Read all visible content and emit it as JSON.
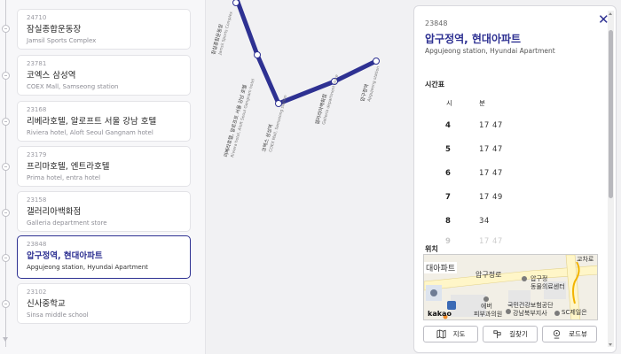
{
  "stops": [
    {
      "code": "24710",
      "ko": "잠실종합운동장",
      "en": "Jamsil Sports Complex",
      "active": false
    },
    {
      "code": "23781",
      "ko": "코엑스 삼성역",
      "en": "COEX Mall, Samseong station",
      "active": false
    },
    {
      "code": "23168",
      "ko": "리베라호텔, 알로프트 서울 강남 호텔",
      "en": "Riviera hotel, Aloft Seoul Gangnam hotel",
      "active": false
    },
    {
      "code": "23179",
      "ko": "프리마호텔, 엔트라호텔",
      "en": "Prima hotel, entra hotel",
      "active": false
    },
    {
      "code": "23158",
      "ko": "갤러리아백화점",
      "en": "Galleria department store",
      "active": false
    },
    {
      "code": "23848",
      "ko": "압구정역, 현대아파트",
      "en": "Apgujeong station, Hyundai Apartment",
      "active": true
    },
    {
      "code": "23102",
      "ko": "신사중학교",
      "en": "Sinsa middle school",
      "active": false
    }
  ],
  "route_labels": [
    {
      "ko": "잠실종합운동장",
      "en": "Jamsil Sports Complex"
    },
    {
      "ko": "리베라호텔, 알로프트 서울 강남 호텔",
      "en": "Riviera hotel, Aloft Seoul Gangnam hotel"
    },
    {
      "ko": "코엑스 삼성역",
      "en": "COEX Mall, Samseong station"
    },
    {
      "ko": "갤러리아백화점",
      "en": "Galleria department store"
    },
    {
      "ko": "압구정역",
      "en": "Apgujeong station"
    }
  ],
  "detail": {
    "code": "23848",
    "title": "압구정역, 현대아파트",
    "subtitle": "Apgujeong station, Hyundai Apartment",
    "close_icon": "close-icon",
    "timetable_title": "시간표",
    "timetable_header": {
      "hour": "시",
      "minute": "분"
    },
    "timetable": [
      {
        "hour": "4",
        "minutes": "17  47"
      },
      {
        "hour": "5",
        "minutes": "17  47"
      },
      {
        "hour": "6",
        "minutes": "17  47"
      },
      {
        "hour": "7",
        "minutes": "17  49"
      },
      {
        "hour": "8",
        "minutes": "34"
      },
      {
        "hour": "9",
        "minutes": "17  47"
      }
    ],
    "location_title": "위치",
    "map_labels": {
      "station": "압구정",
      "station_partial": "대아파트",
      "road": "압구정로",
      "clinic": "압구정\n동물의료센터",
      "clinic1": "압구정",
      "clinic2": "동물의료센터",
      "derm1": "에버",
      "derm2": "피부과의원",
      "nhis1": "국민건강보험공단",
      "nhis2": "강남북부지사",
      "sc": "SC제일은",
      "corner": "교차로",
      "brand": "kakao"
    },
    "buttons": [
      {
        "label": "지도",
        "icon": "map-icon"
      },
      {
        "label": "길찾기",
        "icon": "directions-icon"
      },
      {
        "label": "로드뷰",
        "icon": "roadview-icon"
      }
    ]
  },
  "colors": {
    "accent": "#2e3192",
    "route": "#2e3192",
    "panel_bg": "#ffffff",
    "page_bg": "#f1f1f3"
  }
}
